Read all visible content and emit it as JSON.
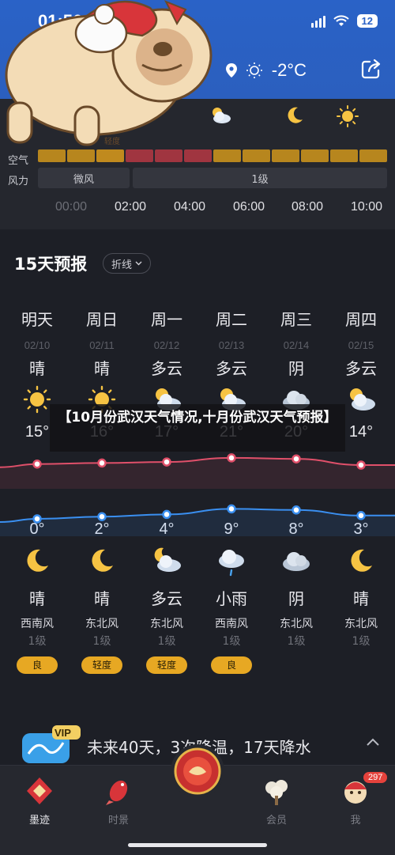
{
  "status": {
    "time": "01:56",
    "battery": "12"
  },
  "header": {
    "temperature": "-2°C"
  },
  "hourly": {
    "air_label": "空气",
    "wind_label": "风力",
    "wind_segments": [
      "微风",
      "1级"
    ],
    "aq_partial_label": "轻度",
    "times": [
      "00:00",
      "02:00",
      "04:00",
      "06:00",
      "08:00",
      "10:00"
    ]
  },
  "forecast": {
    "title": "15天预报",
    "mode_label": "折线",
    "days": [
      {
        "day": "明天",
        "date": "02/10",
        "day_cond": "晴",
        "high": "15°",
        "low": "0°",
        "night_cond": "晴",
        "wind_dir": "西南风",
        "wind_level": "1级",
        "aqi": "良"
      },
      {
        "day": "周日",
        "date": "02/11",
        "day_cond": "晴",
        "high": "16°",
        "low": "2°",
        "night_cond": "晴",
        "wind_dir": "东北风",
        "wind_level": "1级",
        "aqi": "轻度"
      },
      {
        "day": "周一",
        "date": "02/12",
        "day_cond": "多云",
        "high": "17°",
        "low": "4°",
        "night_cond": "多云",
        "wind_dir": "东北风",
        "wind_level": "1级",
        "aqi": "轻度"
      },
      {
        "day": "周二",
        "date": "02/13",
        "day_cond": "多云",
        "high": "21°",
        "low": "9°",
        "night_cond": "小雨",
        "wind_dir": "西南风",
        "wind_level": "1级",
        "aqi": "良"
      },
      {
        "day": "周三",
        "date": "02/14",
        "day_cond": "阴",
        "high": "20°",
        "low": "8°",
        "night_cond": "阴",
        "wind_dir": "东北风",
        "wind_level": "1级",
        "aqi": ""
      },
      {
        "day": "周四",
        "date": "02/15",
        "day_cond": "多云",
        "high": "14°",
        "low": "3°",
        "night_cond": "晴",
        "wind_dir": "东北风",
        "wind_level": "1级",
        "aqi": ""
      }
    ]
  },
  "banner": {
    "text": "【10月份武汉天气情况,十月份武汉天气预报】"
  },
  "vip": {
    "badge": "VIP",
    "text": "未来40天，3次降温，17天降水"
  },
  "tabs": [
    {
      "label": "墨迹",
      "icon": "moji-logo-icon",
      "active": true
    },
    {
      "label": "时景",
      "icon": "koi-fish-icon",
      "active": false
    },
    {
      "label": "会员",
      "icon": "member-tree-icon",
      "active": false
    },
    {
      "label": "我",
      "icon": "profile-mascot-icon",
      "active": false,
      "badge": "297"
    }
  ],
  "colors": {
    "header_blue": "#2a62c7",
    "high_line": "#e0506a",
    "low_line": "#3a8ff0",
    "aqi_yellow": "#e7a823"
  }
}
